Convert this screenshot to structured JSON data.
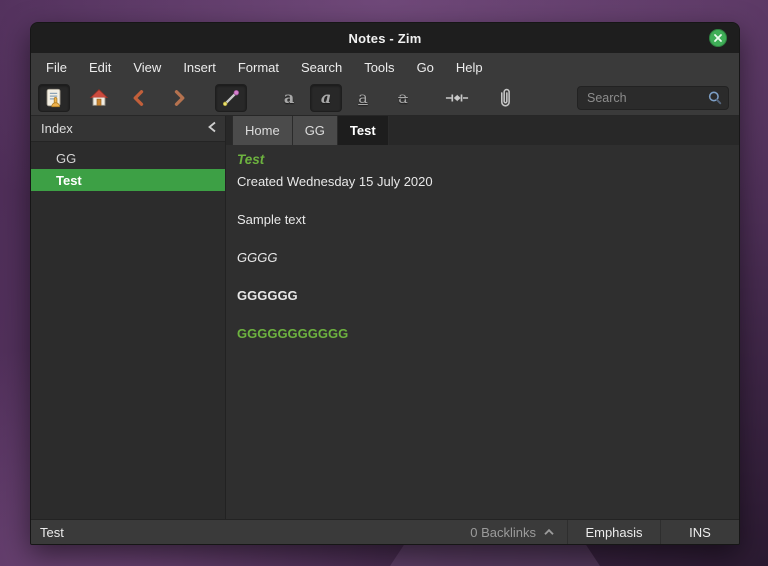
{
  "window": {
    "title": "Notes - Zim"
  },
  "menubar": {
    "items": [
      "File",
      "Edit",
      "View",
      "Insert",
      "Format",
      "Search",
      "Tools",
      "Go",
      "Help"
    ]
  },
  "toolbar": {
    "search_placeholder": "Search",
    "format_letter": "a"
  },
  "sidebar": {
    "header": "Index",
    "items": [
      {
        "label": "GG",
        "selected": false
      },
      {
        "label": "Test",
        "selected": true
      }
    ]
  },
  "tabs": [
    {
      "label": "Home",
      "active": false
    },
    {
      "label": "GG",
      "active": false
    },
    {
      "label": "Test",
      "active": true
    }
  ],
  "page": {
    "title": "Test",
    "created": "Created Wednesday 15 July 2020",
    "sample": "Sample text",
    "emphasis_line": "GGGG",
    "strong_line": "GGGGGG",
    "heading_line": "GGGGGGGGGGG"
  },
  "statusbar": {
    "page": "Test",
    "backlinks": "0 Backlinks",
    "style": "Emphasis",
    "mode": "INS"
  },
  "colors": {
    "selection_green": "#3da045",
    "heading_green": "#6db33f",
    "close_button_green": "#3fae57",
    "desktop_purple": "#56345f",
    "titlebar": "#1e1e1e",
    "toolbar_bg": "#3a3a3a",
    "content_bg": "#2f2f2f"
  }
}
